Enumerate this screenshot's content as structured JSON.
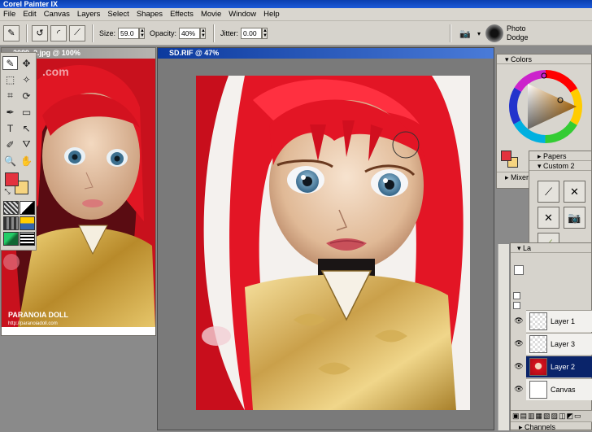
{
  "app": {
    "title": "Corel Painter IX"
  },
  "menu": [
    "File",
    "Edit",
    "Canvas",
    "Layers",
    "Select",
    "Shapes",
    "Effects",
    "Movie",
    "Window",
    "Help"
  ],
  "property_bar": {
    "size_label": "Size:",
    "size_value": "59.0",
    "opacity_label": "Opacity:",
    "opacity_value": "40%",
    "jitter_label": "Jitter:",
    "jitter_value": "0.00",
    "brush_category": "Photo",
    "brush_variant": "Dodge"
  },
  "windows": {
    "ref_title": "2089_2.jpg @ 100%",
    "ref_watermark": ".com",
    "ref_caption": "PARANOIA DOLL",
    "ref_url": "http://paranoiadoll.com",
    "main_title": "SD.RIF @ 47%"
  },
  "panels": {
    "colors": "Colors",
    "mixer": "Mixer",
    "papers": "Papers",
    "custom": "Custom 2",
    "layers_short": "La",
    "channels": "Channels"
  },
  "layers": [
    {
      "name": "Layer 1",
      "selected": false
    },
    {
      "name": "Layer 3",
      "selected": false
    },
    {
      "name": "Layer 2",
      "selected": true
    },
    {
      "name": "Canvas",
      "selected": false
    }
  ],
  "colors": {
    "primary": "#e3323e",
    "secondary": "#f6d480",
    "selection": "#0a246a",
    "title_active": "#0c3a9e"
  }
}
